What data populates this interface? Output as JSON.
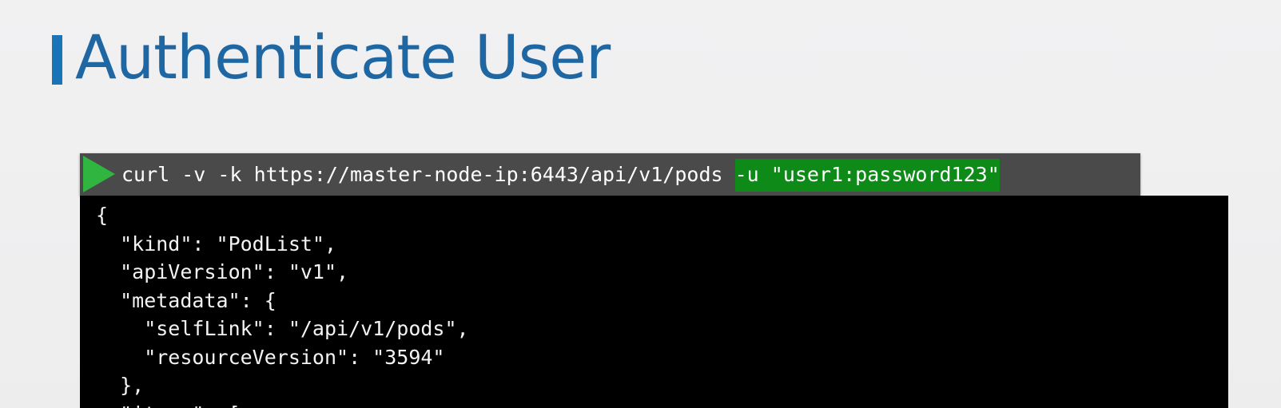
{
  "slide": {
    "title": "Authenticate User"
  },
  "command": {
    "prompt_icon": "play-triangle-icon",
    "text": "curl -v -k https://master-node-ip:6443/api/v1/pods ",
    "highlighted_args": "-u \"user1:password123\""
  },
  "output": {
    "lines": [
      "{",
      "  \"kind\": \"PodList\",",
      "  \"apiVersion\": \"v1\",",
      "  \"metadata\": {",
      "    \"selfLink\": \"/api/v1/pods\",",
      "    \"resourceVersion\": \"3594\"",
      "  },",
      "  \"items\": ["
    ]
  },
  "colors": {
    "title": "#1f67a3",
    "accent_bar": "#1a74b8",
    "command_background": "#4a4a4a",
    "play_icon": "#2fb540",
    "highlight": "#0d8a17",
    "terminal_background": "#000000"
  }
}
